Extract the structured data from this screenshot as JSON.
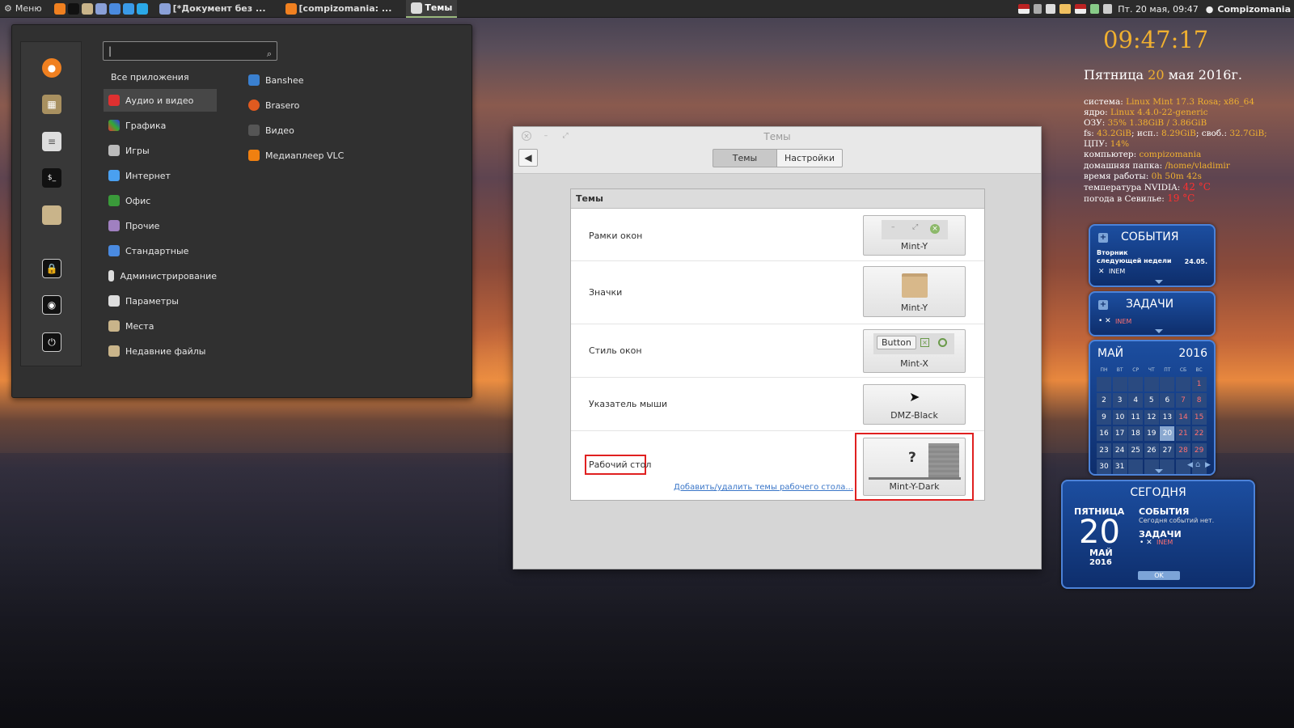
{
  "panel": {
    "menu_label": "Меню",
    "tasks": [
      "[*Документ без ...",
      "[compizomania: ...",
      "Темы"
    ],
    "datetime": "Пт.  20 мая, 09:47",
    "user": "Compizomania"
  },
  "menu": {
    "search_value": "|",
    "all_apps": "Все приложения",
    "categories": [
      "Аудио и видео",
      "Графика",
      "Игры",
      "Интернет",
      "Офис",
      "Прочие",
      "Стандартные",
      "Администрирование",
      "Параметры",
      "Места",
      "Недавние файлы"
    ],
    "apps": [
      "Banshee",
      "Brasero",
      "Видео",
      "Медиаплеер VLC"
    ]
  },
  "window": {
    "title": "Темы",
    "tabs": [
      "Темы",
      "Настройки"
    ],
    "section": "Темы",
    "rows": [
      {
        "label": "Рамки окон",
        "value": "Mint-Y"
      },
      {
        "label": "Значки",
        "value": "Mint-Y"
      },
      {
        "label": "Стиль окон",
        "value": "Mint-X",
        "button_text": "Button"
      },
      {
        "label": "Указатель мыши",
        "value": "DMZ-Black"
      },
      {
        "label": "Рабочий стол",
        "value": "Mint-Y-Dark"
      }
    ],
    "link": "Добавить/удалить темы рабочего стола...",
    "question": "?"
  },
  "conky": {
    "time": "09:47:17",
    "date_prefix": "Пятница ",
    "date_day": "20",
    "date_suffix": " мая 2016г.",
    "lines": [
      {
        "k": "система: ",
        "v": "Linux Mint 17.3 Rosa; x86_64"
      },
      {
        "k": "ядро: ",
        "v": "Linux 4.4.0-22-generic"
      },
      {
        "k": "ОЗУ: ",
        "v": "35% 1.38GiB / 3.86GiB"
      },
      {
        "k": "fs: ",
        "v": "43.2GiB",
        "k2": "; исп.: ",
        "v2": "8.29GiB",
        "k3": "; своб.: ",
        "v3": "32.7GiB;"
      },
      {
        "k": "ЦПУ: ",
        "v": "14%"
      },
      {
        "k": "компьютер: ",
        "v": "compizomania"
      },
      {
        "k": "домашняя папка: ",
        "v": "/home/vladimir"
      },
      {
        "k": "время работы: ",
        "v": "0h 50m 42s"
      },
      {
        "k": "температура NVIDIA: ",
        "r": "42 °C"
      },
      {
        "k": "погода в Севилье: ",
        "r": "19 °C"
      }
    ]
  },
  "events": {
    "title": "СОБЫТИЯ",
    "text": "Вторник следующей недели",
    "date": "24.05.",
    "item": "INEM"
  },
  "tasks": {
    "title": "ЗАДАЧИ",
    "item": "INEM"
  },
  "calendar": {
    "month": "МАЙ",
    "year": "2016",
    "weekdays": [
      "ПН",
      "ВТ",
      "СР",
      "ЧТ",
      "ПТ",
      "СБ",
      "ВС"
    ],
    "days": [
      "1",
      "2",
      "3",
      "4",
      "5",
      "6",
      "7",
      "8",
      "9",
      "10",
      "11",
      "12",
      "13",
      "14",
      "15",
      "16",
      "17",
      "18",
      "19",
      "20",
      "21",
      "22",
      "23",
      "24",
      "25",
      "26",
      "27",
      "28",
      "29",
      "30",
      "31"
    ]
  },
  "today": {
    "title": "СЕГОДНЯ",
    "weekday": "ПЯТНИЦА",
    "day": "20",
    "month": "МАЙ",
    "year": "2016",
    "events_title": "СОБЫТИЯ",
    "events_text": "Сегодня событий нет.",
    "tasks_title": "ЗАДАЧИ",
    "task_item": "INEM",
    "ok": "OK"
  }
}
